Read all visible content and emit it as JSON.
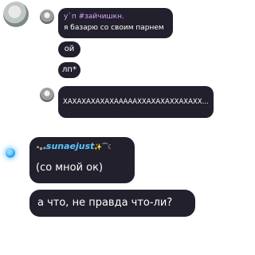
{
  "messages": [
    {
      "sender": "у`п #зайчишкн.",
      "text": "я базарю со своим парнем"
    },
    {
      "text": "ой"
    },
    {
      "text": "лп*"
    },
    {
      "text": "ХАХАХАХАХАХАААААХХАХАХАХХАХАХХ..."
    },
    {
      "sender": "sunaejust",
      "sender_decor_left": "⋆｡ₒ",
      "sender_decor_right": "✨⁀☾",
      "text": "(со мной ок)"
    },
    {
      "text": "а что, не правда что-ли?"
    }
  ],
  "colors": {
    "bubble": "#22202d",
    "sender_purple": "#d7a6ff",
    "sender_blue": "#5bc6ff"
  }
}
